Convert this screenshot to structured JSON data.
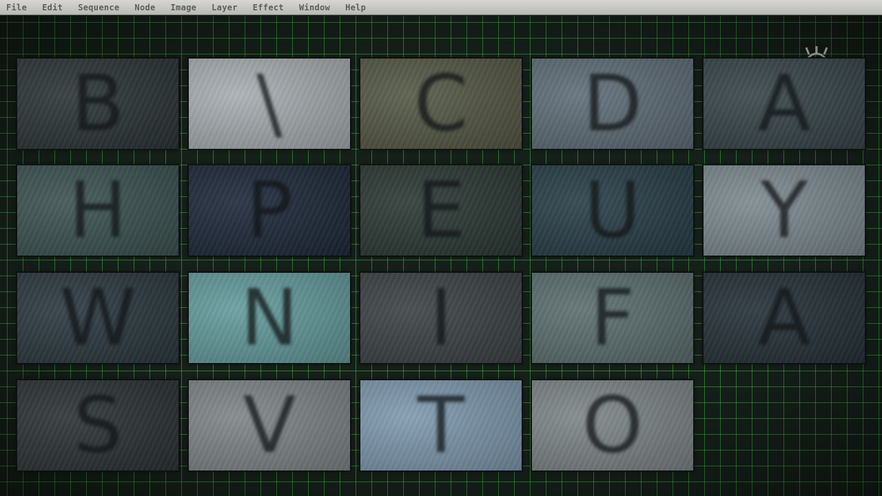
{
  "menu": [
    "File",
    "Edit",
    "Sequence",
    "Node",
    "Image",
    "Layer",
    "Effect",
    "Window",
    "Help"
  ],
  "tiles": [
    {
      "letter": "B",
      "color": "#2b3638"
    },
    {
      "letter": "\\",
      "color": "#a8b0b4"
    },
    {
      "letter": "C",
      "color": "#565a44"
    },
    {
      "letter": "D",
      "color": "#5e6f7c"
    },
    {
      "letter": "A",
      "color": "#37464b"
    },
    {
      "letter": "H",
      "color": "#3b5552"
    },
    {
      "letter": "P",
      "color": "#1d2a3e"
    },
    {
      "letter": "E",
      "color": "#2b3a36"
    },
    {
      "letter": "U",
      "color": "#27404b"
    },
    {
      "letter": "Y",
      "color": "#7b8b92"
    },
    {
      "letter": "W",
      "color": "#2a3a42"
    },
    {
      "letter": "N",
      "color": "#5e9fa0"
    },
    {
      "letter": "I",
      "color": "#3c4446"
    },
    {
      "letter": "F",
      "color": "#5b7170"
    },
    {
      "letter": "A",
      "color": "#24323a"
    },
    {
      "letter": "S",
      "color": "#2b3436"
    },
    {
      "letter": "V",
      "color": "#7f878a"
    },
    {
      "letter": "T",
      "color": "#7c9cb5"
    },
    {
      "letter": "O",
      "color": "#7d878a"
    }
  ],
  "logo_icon": "eye-mascot-icon"
}
